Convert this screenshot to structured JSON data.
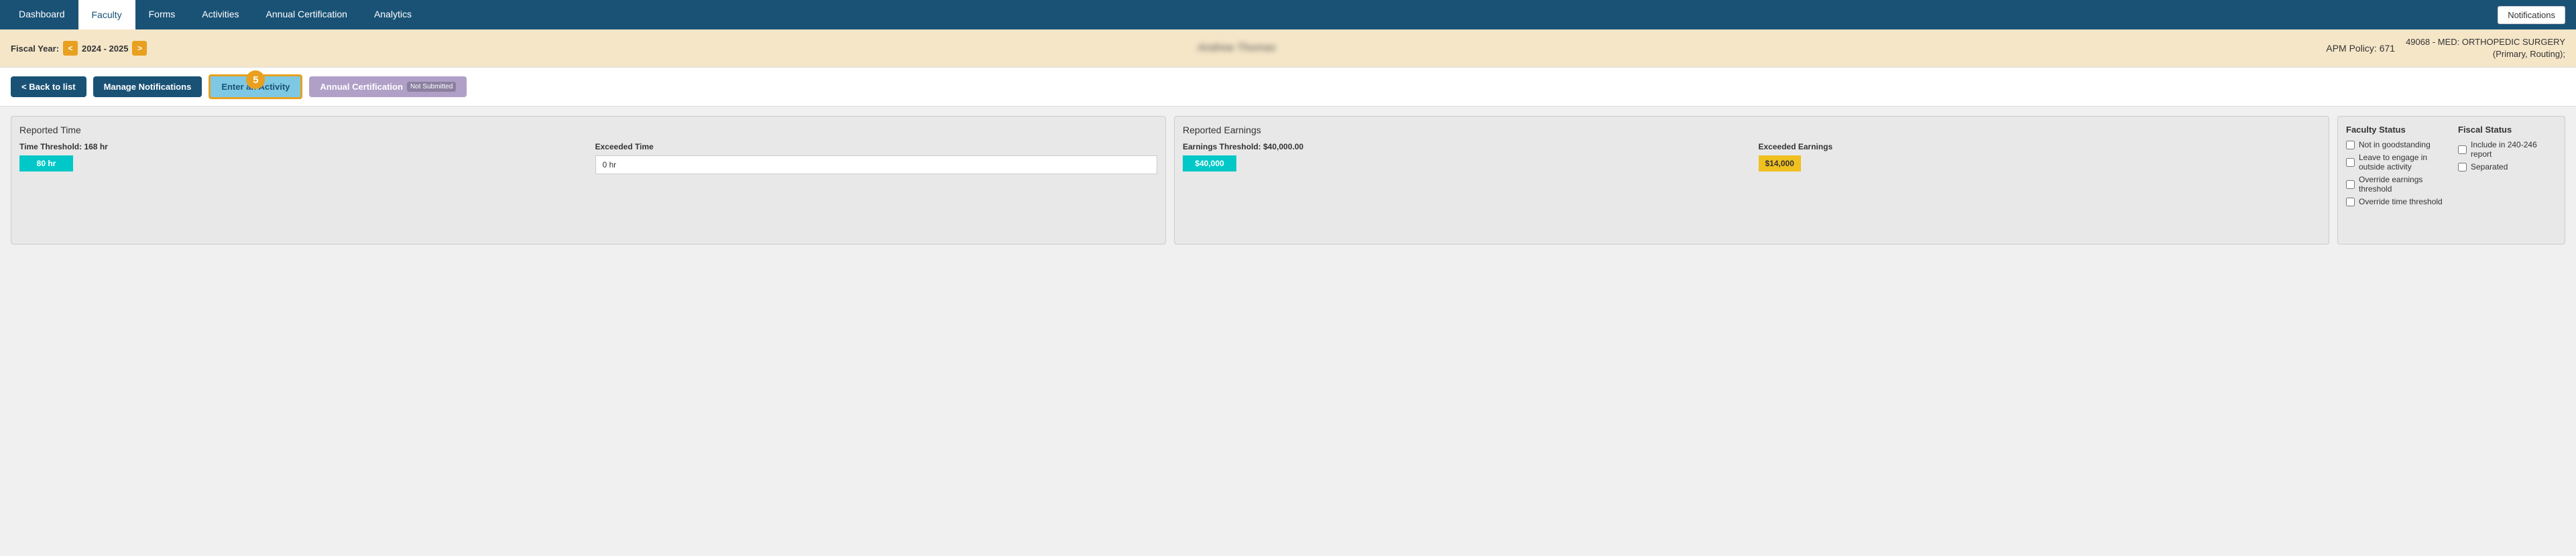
{
  "navbar": {
    "items": [
      {
        "label": "Dashboard",
        "active": false
      },
      {
        "label": "Faculty",
        "active": true
      },
      {
        "label": "Forms",
        "active": false
      },
      {
        "label": "Activities",
        "active": false
      },
      {
        "label": "Annual Certification",
        "active": false
      },
      {
        "label": "Analytics",
        "active": false
      }
    ],
    "notifications_label": "Notifications"
  },
  "header": {
    "fiscal_year_label": "Fiscal Year:",
    "prev_arrow": "<",
    "next_arrow": ">",
    "year_range": "2024 - 2025",
    "faculty_name": "Andrew Thomas",
    "apm_policy": "APM Policy: 671",
    "department_line1": "49068 - MED: ORTHOPEDIC SURGERY",
    "department_line2": "(Primary, Routing);"
  },
  "actions": {
    "back_label": "< Back to list",
    "manage_label": "Manage Notifications",
    "enter_label": "Enter an Activity",
    "annual_label": "Annual Certification",
    "not_submitted_badge": "Not Submitted",
    "badge_number": "5"
  },
  "reported_time": {
    "title": "Reported Time",
    "threshold_label": "Time Threshold: 168 hr",
    "exceeded_label": "Exceeded Time",
    "bar_value": "80 hr",
    "exceeded_value": "0 hr"
  },
  "reported_earnings": {
    "title": "Reported Earnings",
    "threshold_label": "Earnings Threshold: $40,000.00",
    "exceeded_label": "Exceeded Earnings",
    "bar_value": "$40,000",
    "exceeded_value": "$14,000"
  },
  "faculty_status": {
    "title": "Faculty Status",
    "items": [
      {
        "label": "Not in goodstanding",
        "checked": false
      },
      {
        "label": "Leave to engage in outside activity",
        "checked": false
      },
      {
        "label": "Override earnings threshold",
        "checked": false
      },
      {
        "label": "Override time threshold",
        "checked": false
      }
    ]
  },
  "fiscal_status": {
    "title": "Fiscal Status",
    "items": [
      {
        "label": "Include in 240-246 report",
        "checked": false
      },
      {
        "label": "Separated",
        "checked": false
      }
    ]
  }
}
